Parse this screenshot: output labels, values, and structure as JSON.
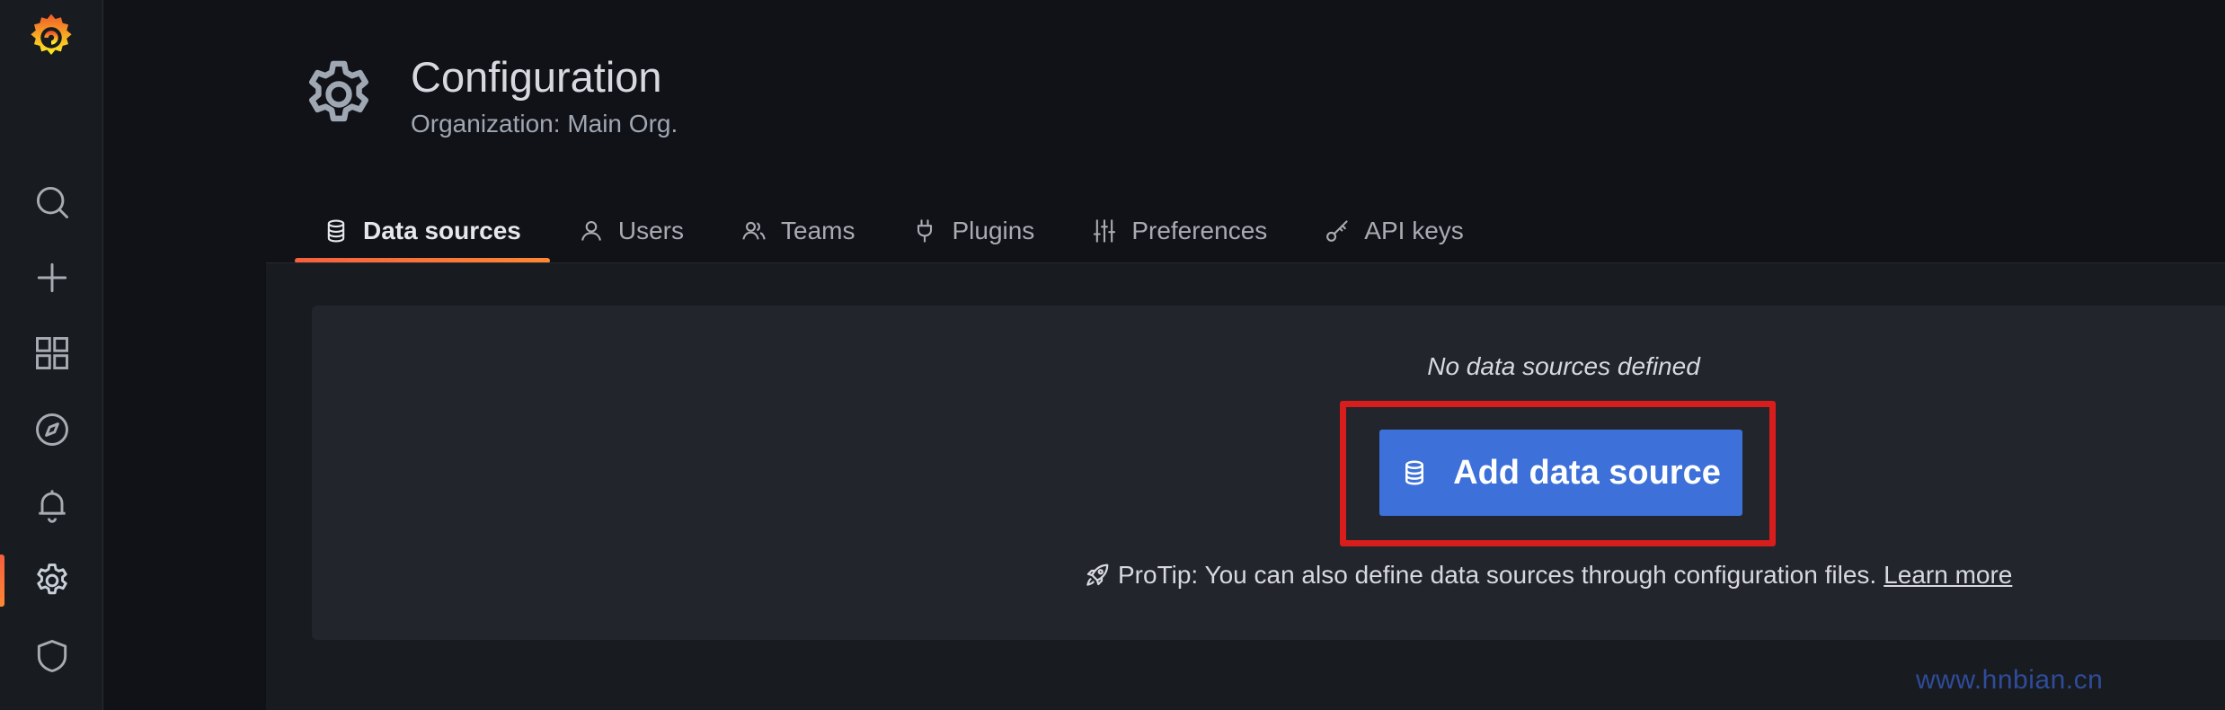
{
  "header": {
    "title": "Configuration",
    "subtitle": "Organization: Main Org."
  },
  "sidebar": {
    "items": [
      {
        "icon": "search-icon"
      },
      {
        "icon": "plus-icon"
      },
      {
        "icon": "dashboards-icon"
      },
      {
        "icon": "compass-icon"
      },
      {
        "icon": "bell-icon"
      },
      {
        "icon": "gear-icon",
        "active": true
      },
      {
        "icon": "shield-icon"
      }
    ]
  },
  "tabs": [
    {
      "label": "Data sources",
      "icon": "database-icon",
      "active": true
    },
    {
      "label": "Users",
      "icon": "user-icon"
    },
    {
      "label": "Teams",
      "icon": "users-icon"
    },
    {
      "label": "Plugins",
      "icon": "plug-icon"
    },
    {
      "label": "Preferences",
      "icon": "sliders-icon"
    },
    {
      "label": "API keys",
      "icon": "key-icon"
    }
  ],
  "empty_state": {
    "title": "No data sources defined",
    "button_label": "Add data source",
    "protip_text": "ProTip: You can also define data sources through configuration files.",
    "protip_link": "Learn more"
  },
  "watermark": "www.hnbian.cn",
  "colors": {
    "accent_gradient": [
      "#f55f3e",
      "#ff8833"
    ],
    "primary_button": "#3d71d9",
    "highlight": "#d81d1d"
  }
}
